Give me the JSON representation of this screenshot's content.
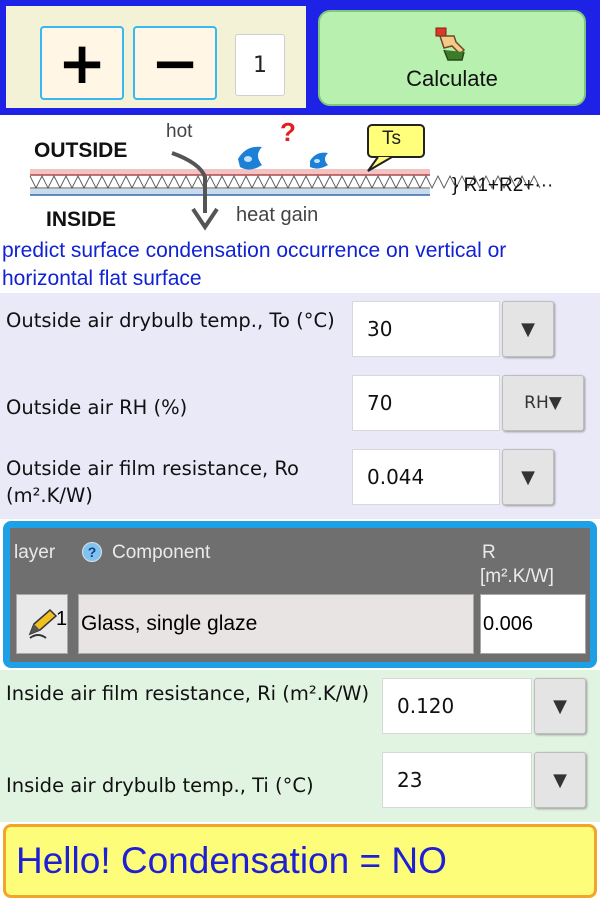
{
  "controls": {
    "plus_label": "+",
    "minus_label": "−",
    "layer_count": "1",
    "calculate_label": "Calculate"
  },
  "diagram": {
    "outside": "OUTSIDE",
    "inside": "INSIDE",
    "hot": "hot",
    "heat_gain": "heat gain",
    "question": "?",
    "ts": "Ts",
    "r_sum": "} R1+R2+···"
  },
  "description": "predict surface condensation occurrence on vertical or horizontal flat surface",
  "outside": {
    "drybulb": {
      "label": "Outside air drybulb temp., To (°C)",
      "value": "30"
    },
    "rh": {
      "label": "Outside air RH (%)",
      "value": "70",
      "button": "RH▼"
    },
    "film": {
      "label": "Outside air film resistance, Ro (m².K/W)",
      "value": "0.044"
    }
  },
  "layers": {
    "header_layer": "layer",
    "header_component": "Component",
    "header_r": "R",
    "header_r_unit": "[m².K/W]",
    "help_icon": "?",
    "rows": [
      {
        "num": "1",
        "component": "Glass, single glaze",
        "r": "0.006"
      }
    ]
  },
  "inside": {
    "film": {
      "label": "Inside air film resistance, Ri (m².K/W)",
      "value": "0.120"
    },
    "drybulb": {
      "label": "Inside air drybulb temp., Ti (°C)",
      "value": "23"
    }
  },
  "dropdown_glyph": "▼",
  "result": "Hello! Condensation = NO",
  "colors": {
    "topbar": "#1e22e6",
    "calc_button": "#b8f0b0",
    "description_text": "#1022d4",
    "layer_border": "#1ea0e6",
    "result_bg": "#fdfd7a",
    "result_text": "#1f1fd4"
  },
  "icons": [
    "hand-pointer-icon",
    "water-droplet-icon",
    "heat-arrow-icon",
    "pencil-edit-icon",
    "help-icon",
    "dropdown-arrow-icon"
  ]
}
